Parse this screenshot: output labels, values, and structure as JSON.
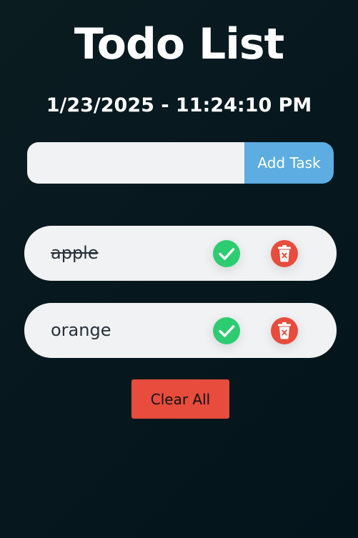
{
  "app": {
    "title": "Todo List",
    "datetime": "1/23/2025 - 11:24:10 PM"
  },
  "input": {
    "value": "",
    "placeholder": "",
    "add_label": "Add Task"
  },
  "tasks": [
    {
      "text": "apple",
      "completed": true
    },
    {
      "text": "orange",
      "completed": false
    }
  ],
  "clear_all_label": "Clear All",
  "colors": {
    "background": "#06171d",
    "add_button": "#5dade2",
    "check": "#2ecc71",
    "delete": "#e74c3c",
    "clear_button": "#e74c3c"
  },
  "icons": {
    "complete": "check-circle-icon",
    "delete": "trash-icon"
  }
}
